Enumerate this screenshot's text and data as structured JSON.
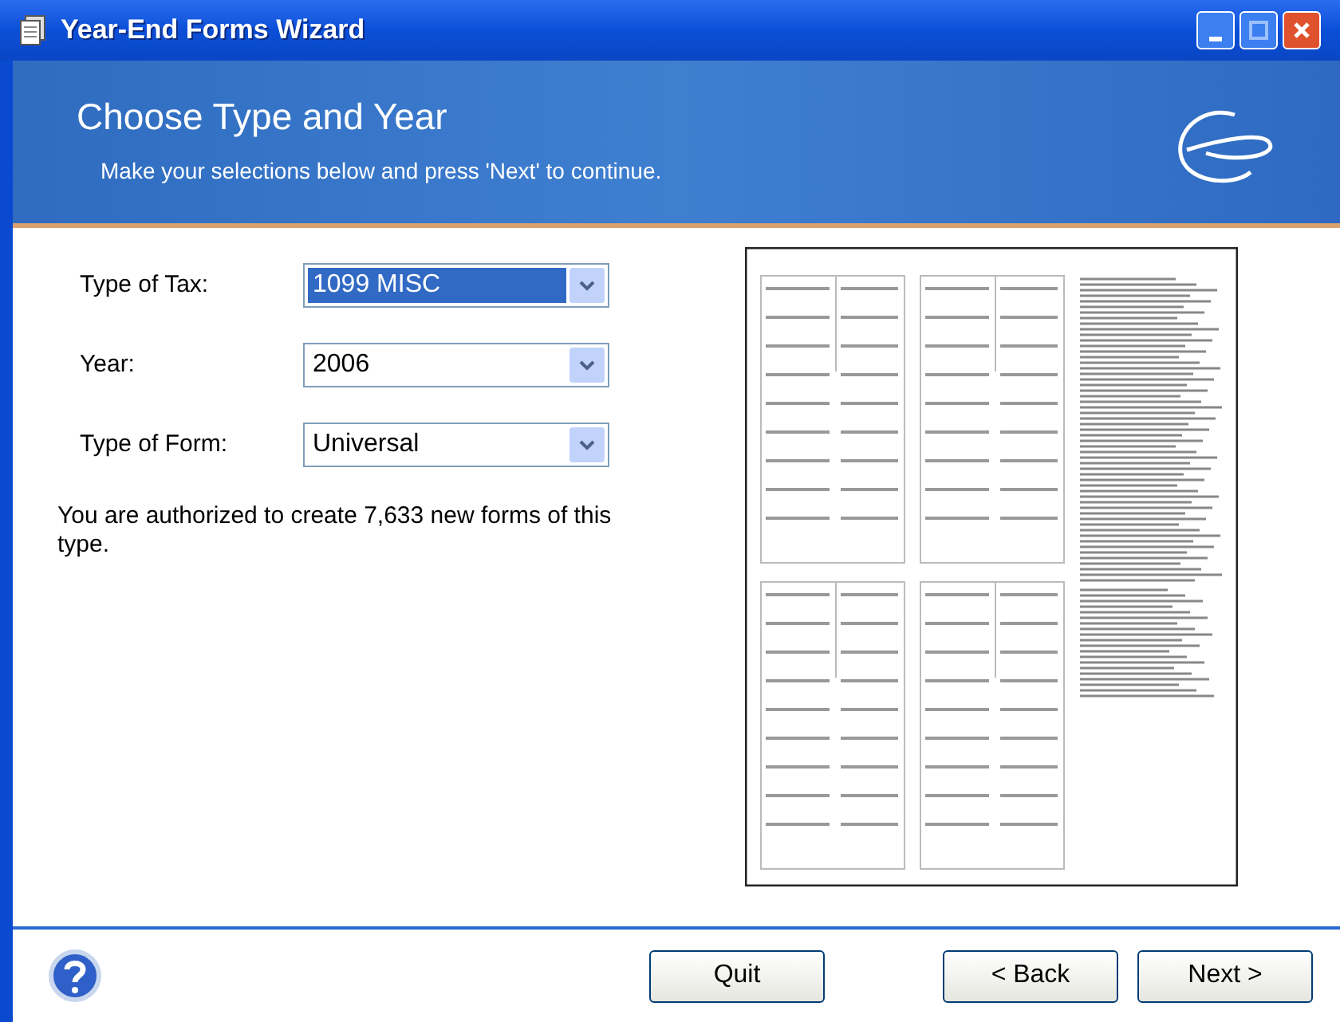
{
  "window": {
    "title": "Year-End Forms Wizard"
  },
  "header": {
    "title": "Choose Type and Year",
    "subtitle": "Make your selections below and press 'Next' to continue."
  },
  "fields": [
    {
      "label": "Type of Tax:",
      "value": "1099 MISC",
      "highlighted": true
    },
    {
      "label": "Year:",
      "value": "2006",
      "highlighted": false
    },
    {
      "label": "Type of Form:",
      "value": "Universal",
      "highlighted": false
    }
  ],
  "message": "You are authorized to create 7,633 new forms of this type.",
  "buttons": [
    {
      "label": "Quit",
      "kind": "quit"
    },
    {
      "label": "< Back",
      "kind": "nav"
    },
    {
      "label": "Next >",
      "kind": "nav"
    }
  ]
}
